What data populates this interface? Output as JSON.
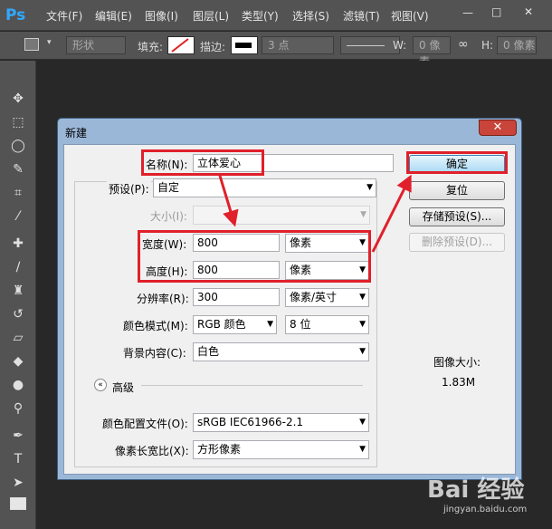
{
  "app": {
    "logo": "Ps"
  },
  "menu": [
    "文件(F)",
    "编辑(E)",
    "图像(I)",
    "图层(L)",
    "类型(Y)",
    "选择(S)",
    "滤镜(T)",
    "视图(V)"
  ],
  "window_controls": {
    "minimize": "—",
    "restore": "□",
    "close": "✕"
  },
  "options": {
    "mode_value": "形状",
    "fill_label": "填充:",
    "stroke_label": "描边:",
    "stroke_size": "3 点",
    "w_label": "W:",
    "w_value": "0 像素",
    "h_label": "H:",
    "h_value": "0 像素"
  },
  "dialog": {
    "title": "新建",
    "close": "✕",
    "name_label": "名称(N):",
    "name_value": "立体爱心",
    "preset_label": "预设(P):",
    "preset_value": "自定",
    "size_label": "大小(I):",
    "width_label": "宽度(W):",
    "width_value": "800",
    "width_unit": "像素",
    "height_label": "高度(H):",
    "height_value": "800",
    "height_unit": "像素",
    "resolution_label": "分辨率(R):",
    "resolution_value": "300",
    "resolution_unit": "像素/英寸",
    "color_mode_label": "颜色模式(M):",
    "color_mode_value": "RGB 颜色",
    "bit_depth_value": "8 位",
    "background_label": "背景内容(C):",
    "background_value": "白色",
    "advanced_label": "高级",
    "advanced_icon": "«",
    "color_profile_label": "颜色配置文件(O):",
    "color_profile_value": "sRGB IEC61966-2.1",
    "pixel_aspect_label": "像素长宽比(X):",
    "pixel_aspect_value": "方形像素",
    "image_size_label": "图像大小:",
    "image_size_value": "1.83M",
    "buttons": {
      "ok": "确定",
      "reset": "复位",
      "save_preset": "存储预设(S)...",
      "delete_preset": "删除预设(D)..."
    }
  },
  "watermark": {
    "logo": "Bai 经验",
    "sub": "jingyan.baidu.com"
  },
  "colors": {
    "annotation_red": "#e0202a",
    "ps_blue": "#31a8ff",
    "dialog_frame": "#9bb7d8"
  }
}
